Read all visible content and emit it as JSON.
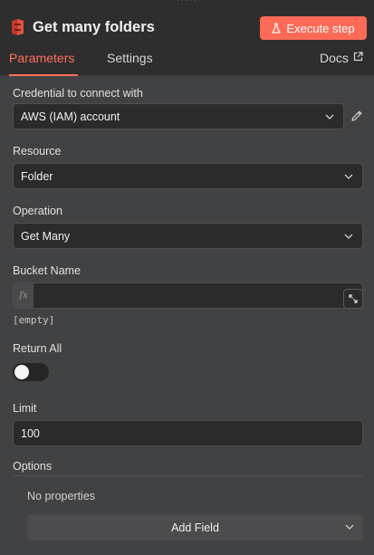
{
  "header": {
    "title": "Get many folders",
    "execute_label": "Execute step"
  },
  "tabs": {
    "parameters": "Parameters",
    "settings": "Settings",
    "docs": "Docs"
  },
  "credential": {
    "label": "Credential to connect with",
    "value": "AWS (IAM) account"
  },
  "resource": {
    "label": "Resource",
    "value": "Folder"
  },
  "operation": {
    "label": "Operation",
    "value": "Get Many"
  },
  "bucket_name": {
    "label": "Bucket Name",
    "value": "",
    "fx": "fx",
    "hint": "[empty]"
  },
  "return_all": {
    "label": "Return All",
    "enabled": false
  },
  "limit": {
    "label": "Limit",
    "value": "100"
  },
  "options": {
    "label": "Options",
    "empty_text": "No properties",
    "add_field_label": "Add Field"
  },
  "colors": {
    "accent": "#ff6f59",
    "execute_button": "#fd6a58",
    "panel_bg": "#414244",
    "header_bg": "#2e2e2f"
  },
  "icons": [
    "s3-node-icon",
    "flask-icon",
    "external-link-icon",
    "chevron-down-icon",
    "pencil-icon",
    "expand-icon"
  ]
}
